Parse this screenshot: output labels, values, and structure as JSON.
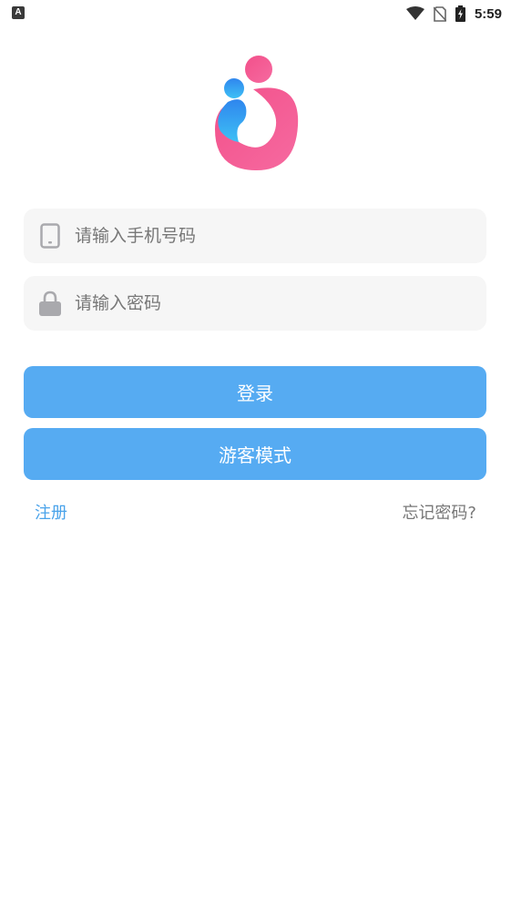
{
  "status_bar": {
    "notification_icon": "A",
    "time": "5:59",
    "icons": [
      "wifi-icon",
      "no-sim-icon",
      "battery-charging-icon"
    ]
  },
  "logo": {
    "name": "app-logo",
    "colors": {
      "blue": "#3a97f0",
      "pink": "#f2508a"
    }
  },
  "form": {
    "phone": {
      "placeholder": "请输入手机号码",
      "value": "",
      "icon": "phone-icon"
    },
    "password": {
      "placeholder": "请输入密码",
      "value": "",
      "icon": "lock-icon"
    }
  },
  "buttons": {
    "login_label": "登录",
    "guest_label": "游客模式",
    "color": "#56abf2"
  },
  "links": {
    "register": "注册",
    "forgot": "忘记密码?"
  }
}
